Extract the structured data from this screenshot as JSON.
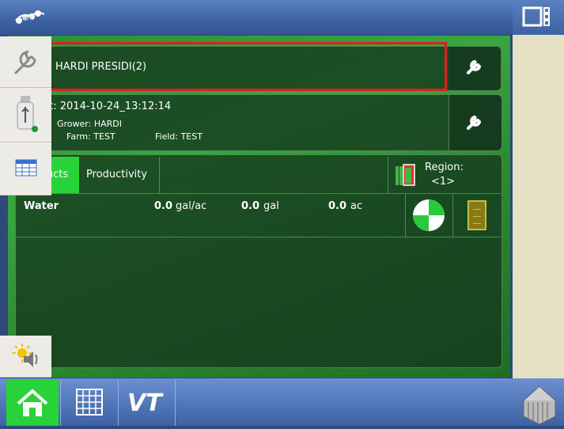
{
  "header": {
    "gps_icon": "gps-signal-icon",
    "display_icon": "display-layout-icon"
  },
  "implement": {
    "status_icon": "checkmark-icon",
    "name": "HARDI PRESIDI(2)"
  },
  "event": {
    "title": "Event: 2014-10-24_13:12:14",
    "grower": "Grower: HARDI",
    "farm": "Farm: TEST",
    "field": "Field: TEST"
  },
  "tabs": [
    {
      "label": "Products"
    },
    {
      "label": "Productivity"
    }
  ],
  "region": {
    "label": "Region:",
    "value": "<1>"
  },
  "product_row": {
    "name": "Water",
    "rate_value": "0.0",
    "rate_unit": "gal/ac",
    "total_value": "0.0",
    "total_unit": "gal",
    "area_value": "0.0",
    "area_unit": "ac"
  },
  "colors": {
    "highlight": "#e31b23",
    "active_tab": "#28d33a",
    "accent_green": "#3aa53f"
  },
  "bottom_nav": {
    "home": "home-icon",
    "grid": "grid-icon",
    "vt": "VT",
    "map": "map-icon"
  }
}
